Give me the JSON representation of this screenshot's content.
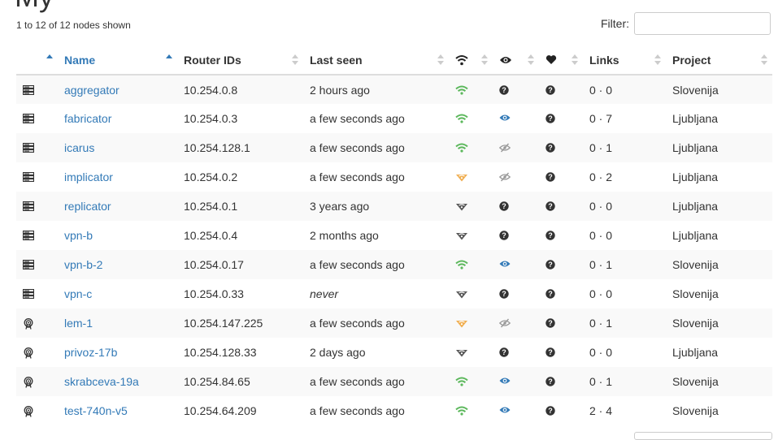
{
  "header": {
    "summary": "1 to 12 of 12 nodes shown",
    "filter_label": "Filter:",
    "filter_value": ""
  },
  "table": {
    "columns": {
      "name": "Name",
      "router_ids": "Router IDs",
      "last_seen": "Last seen",
      "links": "Links",
      "project": "Project"
    },
    "header_icons": [
      "wifi-icon",
      "eye-icon",
      "heart-icon"
    ],
    "rows": [
      {
        "type": "server",
        "name": "aggregator",
        "router_id": "10.254.0.8",
        "last_seen": "2 hours ago",
        "last_seen_italic": false,
        "status": "green",
        "monitored": "unknown",
        "health": "unknown",
        "links": "0 · 0",
        "project": "Slovenija"
      },
      {
        "type": "server",
        "name": "fabricator",
        "router_id": "10.254.0.3",
        "last_seen": "a few seconds ago",
        "last_seen_italic": false,
        "status": "green",
        "monitored": "eye",
        "health": "unknown",
        "links": "0 · 7",
        "project": "Ljubljana"
      },
      {
        "type": "server",
        "name": "icarus",
        "router_id": "10.254.128.1",
        "last_seen": "a few seconds ago",
        "last_seen_italic": false,
        "status": "green",
        "monitored": "eye-slash",
        "health": "unknown",
        "links": "0 · 1",
        "project": "Ljubljana"
      },
      {
        "type": "server",
        "name": "implicator",
        "router_id": "10.254.0.2",
        "last_seen": "a few seconds ago",
        "last_seen_italic": false,
        "status": "orange",
        "monitored": "eye-slash",
        "health": "unknown",
        "links": "0 · 2",
        "project": "Ljubljana"
      },
      {
        "type": "server",
        "name": "replicator",
        "router_id": "10.254.0.1",
        "last_seen": "3 years ago",
        "last_seen_italic": false,
        "status": "gray",
        "monitored": "unknown",
        "health": "unknown",
        "links": "0 · 0",
        "project": "Ljubljana"
      },
      {
        "type": "server",
        "name": "vpn-b",
        "router_id": "10.254.0.4",
        "last_seen": "2 months ago",
        "last_seen_italic": false,
        "status": "gray",
        "monitored": "unknown",
        "health": "unknown",
        "links": "0 · 0",
        "project": "Ljubljana"
      },
      {
        "type": "server",
        "name": "vpn-b-2",
        "router_id": "10.254.0.17",
        "last_seen": "a few seconds ago",
        "last_seen_italic": false,
        "status": "green",
        "monitored": "eye",
        "health": "unknown",
        "links": "0 · 1",
        "project": "Slovenija"
      },
      {
        "type": "server",
        "name": "vpn-c",
        "router_id": "10.254.0.33",
        "last_seen": "never",
        "last_seen_italic": true,
        "status": "gray",
        "monitored": "unknown",
        "health": "unknown",
        "links": "0 · 0",
        "project": "Slovenija"
      },
      {
        "type": "antenna",
        "name": "lem-1",
        "router_id": "10.254.147.225",
        "last_seen": "a few seconds ago",
        "last_seen_italic": false,
        "status": "orange",
        "monitored": "eye-slash",
        "health": "unknown",
        "links": "0 · 1",
        "project": "Slovenija"
      },
      {
        "type": "antenna",
        "name": "privoz-17b",
        "router_id": "10.254.128.33",
        "last_seen": "2 days ago",
        "last_seen_italic": false,
        "status": "gray",
        "monitored": "unknown",
        "health": "unknown",
        "links": "0 · 0",
        "project": "Ljubljana"
      },
      {
        "type": "antenna",
        "name": "skrabceva-19a",
        "router_id": "10.254.84.65",
        "last_seen": "a few seconds ago",
        "last_seen_italic": false,
        "status": "green",
        "monitored": "eye",
        "health": "unknown",
        "links": "0 · 1",
        "project": "Slovenija"
      },
      {
        "type": "antenna",
        "name": "test-740n-v5",
        "router_id": "10.254.64.209",
        "last_seen": "a few seconds ago",
        "last_seen_italic": false,
        "status": "green",
        "monitored": "eye",
        "health": "unknown",
        "links": "2 · 4",
        "project": "Slovenija"
      }
    ]
  },
  "colors": {
    "link": "#337ab7",
    "green": "#5cb85c",
    "orange": "#f0ad4e",
    "gray": "#555555",
    "blue": "#337ab7",
    "dark": "#333333"
  }
}
